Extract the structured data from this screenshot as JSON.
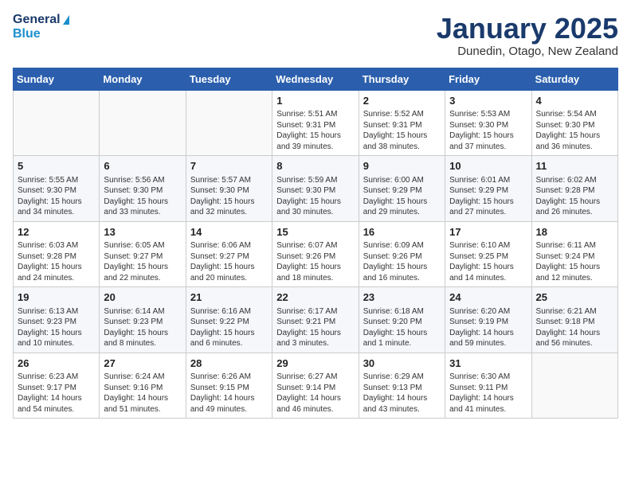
{
  "header": {
    "logo_general": "General",
    "logo_blue": "Blue",
    "month_title": "January 2025",
    "location": "Dunedin, Otago, New Zealand"
  },
  "weekdays": [
    "Sunday",
    "Monday",
    "Tuesday",
    "Wednesday",
    "Thursday",
    "Friday",
    "Saturday"
  ],
  "weeks": [
    [
      {
        "day": "",
        "info": ""
      },
      {
        "day": "",
        "info": ""
      },
      {
        "day": "",
        "info": ""
      },
      {
        "day": "1",
        "info": "Sunrise: 5:51 AM\nSunset: 9:31 PM\nDaylight: 15 hours\nand 39 minutes."
      },
      {
        "day": "2",
        "info": "Sunrise: 5:52 AM\nSunset: 9:31 PM\nDaylight: 15 hours\nand 38 minutes."
      },
      {
        "day": "3",
        "info": "Sunrise: 5:53 AM\nSunset: 9:30 PM\nDaylight: 15 hours\nand 37 minutes."
      },
      {
        "day": "4",
        "info": "Sunrise: 5:54 AM\nSunset: 9:30 PM\nDaylight: 15 hours\nand 36 minutes."
      }
    ],
    [
      {
        "day": "5",
        "info": "Sunrise: 5:55 AM\nSunset: 9:30 PM\nDaylight: 15 hours\nand 34 minutes."
      },
      {
        "day": "6",
        "info": "Sunrise: 5:56 AM\nSunset: 9:30 PM\nDaylight: 15 hours\nand 33 minutes."
      },
      {
        "day": "7",
        "info": "Sunrise: 5:57 AM\nSunset: 9:30 PM\nDaylight: 15 hours\nand 32 minutes."
      },
      {
        "day": "8",
        "info": "Sunrise: 5:59 AM\nSunset: 9:30 PM\nDaylight: 15 hours\nand 30 minutes."
      },
      {
        "day": "9",
        "info": "Sunrise: 6:00 AM\nSunset: 9:29 PM\nDaylight: 15 hours\nand 29 minutes."
      },
      {
        "day": "10",
        "info": "Sunrise: 6:01 AM\nSunset: 9:29 PM\nDaylight: 15 hours\nand 27 minutes."
      },
      {
        "day": "11",
        "info": "Sunrise: 6:02 AM\nSunset: 9:28 PM\nDaylight: 15 hours\nand 26 minutes."
      }
    ],
    [
      {
        "day": "12",
        "info": "Sunrise: 6:03 AM\nSunset: 9:28 PM\nDaylight: 15 hours\nand 24 minutes."
      },
      {
        "day": "13",
        "info": "Sunrise: 6:05 AM\nSunset: 9:27 PM\nDaylight: 15 hours\nand 22 minutes."
      },
      {
        "day": "14",
        "info": "Sunrise: 6:06 AM\nSunset: 9:27 PM\nDaylight: 15 hours\nand 20 minutes."
      },
      {
        "day": "15",
        "info": "Sunrise: 6:07 AM\nSunset: 9:26 PM\nDaylight: 15 hours\nand 18 minutes."
      },
      {
        "day": "16",
        "info": "Sunrise: 6:09 AM\nSunset: 9:26 PM\nDaylight: 15 hours\nand 16 minutes."
      },
      {
        "day": "17",
        "info": "Sunrise: 6:10 AM\nSunset: 9:25 PM\nDaylight: 15 hours\nand 14 minutes."
      },
      {
        "day": "18",
        "info": "Sunrise: 6:11 AM\nSunset: 9:24 PM\nDaylight: 15 hours\nand 12 minutes."
      }
    ],
    [
      {
        "day": "19",
        "info": "Sunrise: 6:13 AM\nSunset: 9:23 PM\nDaylight: 15 hours\nand 10 minutes."
      },
      {
        "day": "20",
        "info": "Sunrise: 6:14 AM\nSunset: 9:23 PM\nDaylight: 15 hours\nand 8 minutes."
      },
      {
        "day": "21",
        "info": "Sunrise: 6:16 AM\nSunset: 9:22 PM\nDaylight: 15 hours\nand 6 minutes."
      },
      {
        "day": "22",
        "info": "Sunrise: 6:17 AM\nSunset: 9:21 PM\nDaylight: 15 hours\nand 3 minutes."
      },
      {
        "day": "23",
        "info": "Sunrise: 6:18 AM\nSunset: 9:20 PM\nDaylight: 15 hours\nand 1 minute."
      },
      {
        "day": "24",
        "info": "Sunrise: 6:20 AM\nSunset: 9:19 PM\nDaylight: 14 hours\nand 59 minutes."
      },
      {
        "day": "25",
        "info": "Sunrise: 6:21 AM\nSunset: 9:18 PM\nDaylight: 14 hours\nand 56 minutes."
      }
    ],
    [
      {
        "day": "26",
        "info": "Sunrise: 6:23 AM\nSunset: 9:17 PM\nDaylight: 14 hours\nand 54 minutes."
      },
      {
        "day": "27",
        "info": "Sunrise: 6:24 AM\nSunset: 9:16 PM\nDaylight: 14 hours\nand 51 minutes."
      },
      {
        "day": "28",
        "info": "Sunrise: 6:26 AM\nSunset: 9:15 PM\nDaylight: 14 hours\nand 49 minutes."
      },
      {
        "day": "29",
        "info": "Sunrise: 6:27 AM\nSunset: 9:14 PM\nDaylight: 14 hours\nand 46 minutes."
      },
      {
        "day": "30",
        "info": "Sunrise: 6:29 AM\nSunset: 9:13 PM\nDaylight: 14 hours\nand 43 minutes."
      },
      {
        "day": "31",
        "info": "Sunrise: 6:30 AM\nSunset: 9:11 PM\nDaylight: 14 hours\nand 41 minutes."
      },
      {
        "day": "",
        "info": ""
      }
    ]
  ]
}
